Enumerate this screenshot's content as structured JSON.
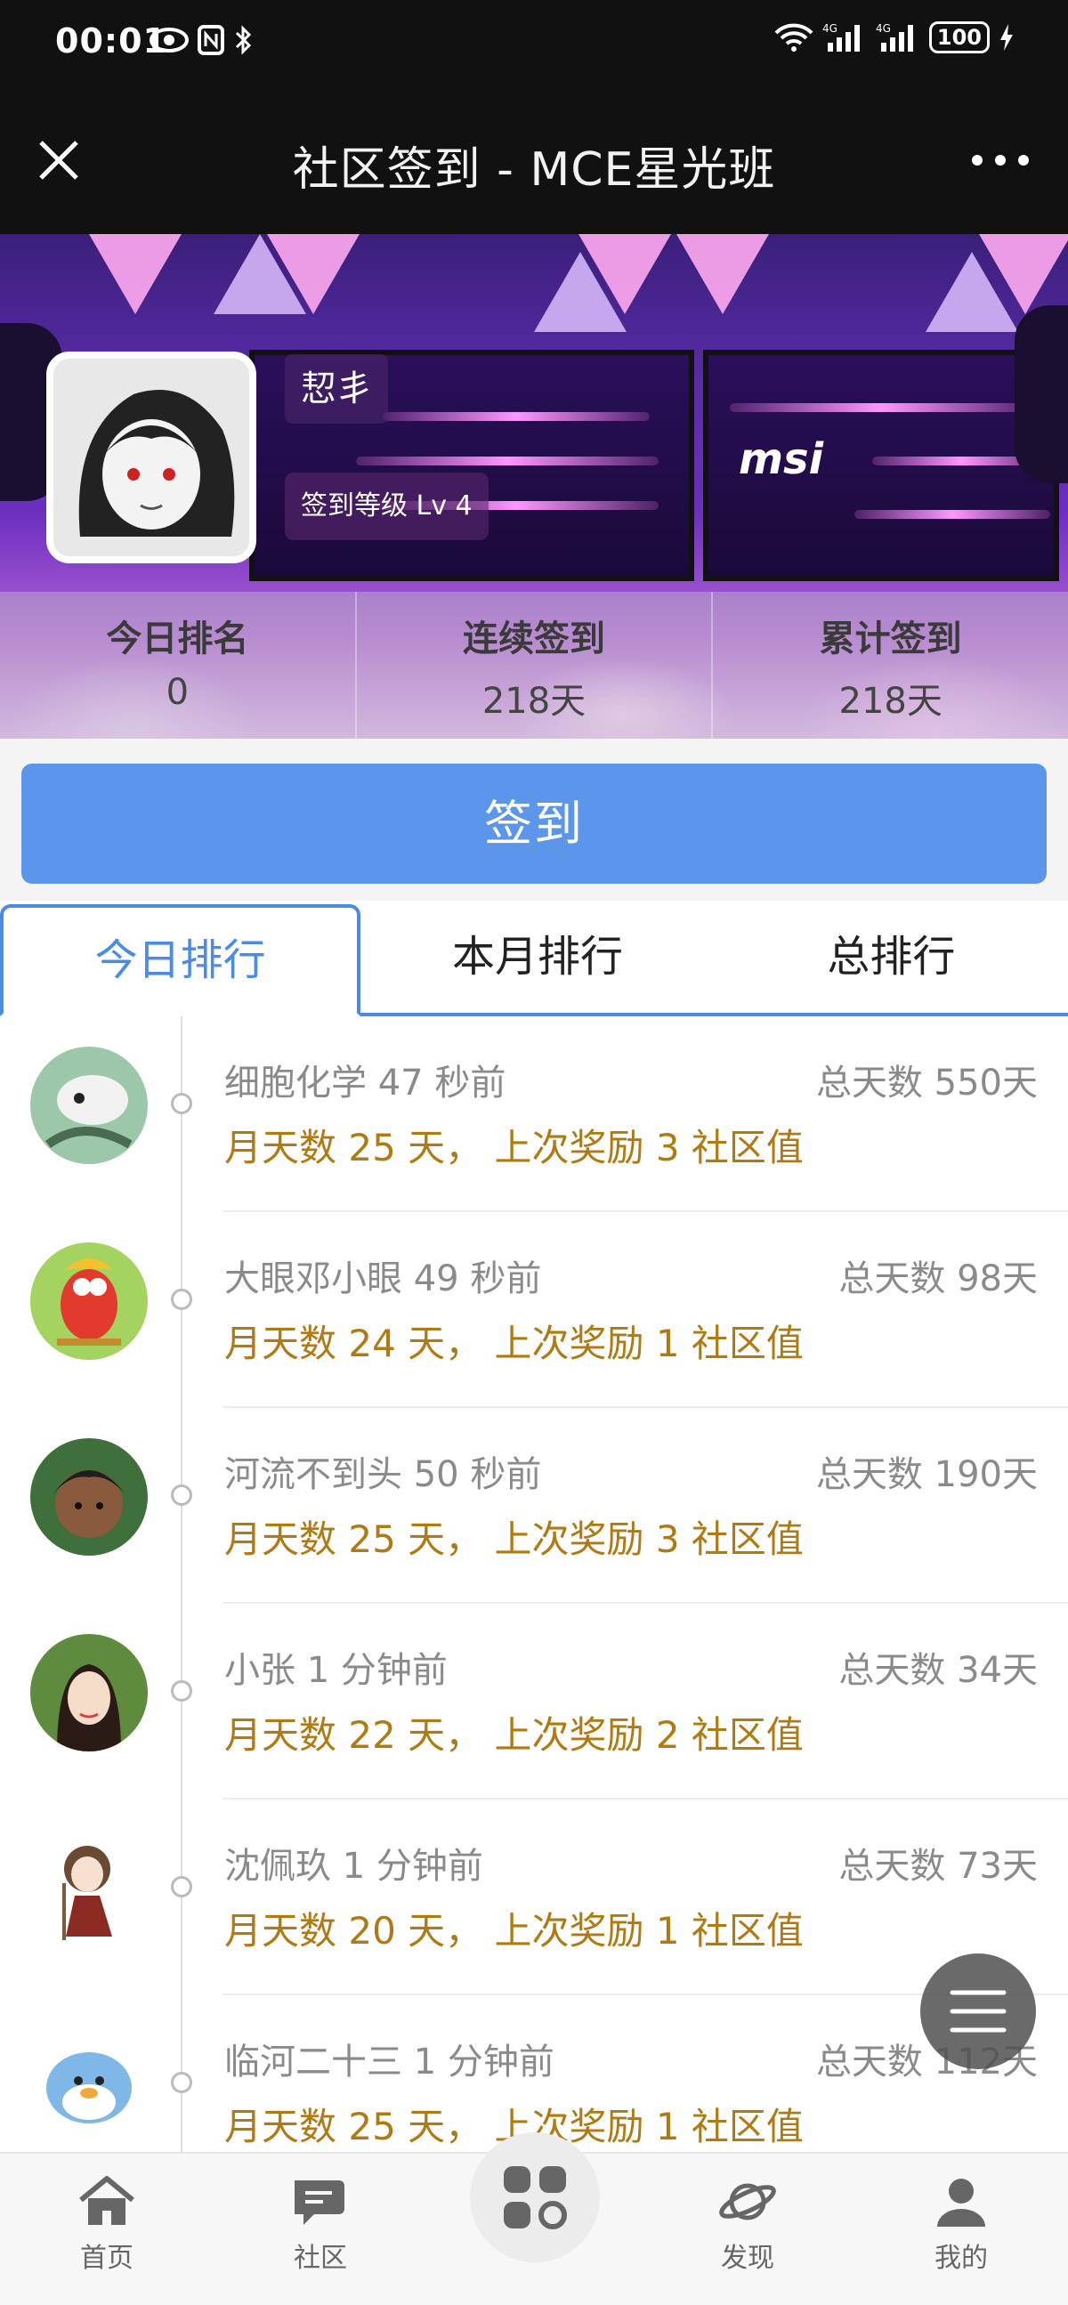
{
  "status_bar": {
    "time": "00:01",
    "battery": "100"
  },
  "title_bar": {
    "title": "社区签到 - MCE星光班"
  },
  "profile": {
    "username": "恝丯",
    "level": "签到等级 Lv 4",
    "stats": [
      {
        "label": "今日排名",
        "value": "0"
      },
      {
        "label": "连续签到",
        "value": "218天"
      },
      {
        "label": "累计签到",
        "value": "218天"
      }
    ]
  },
  "sign_button": {
    "label": "签到"
  },
  "tabs": [
    {
      "label": "今日排行",
      "active": true
    },
    {
      "label": "本月排行",
      "active": false
    },
    {
      "label": "总排行",
      "active": false
    }
  ],
  "ranking": [
    {
      "name": "细胞化学 47 秒前",
      "total": "总天数 550天",
      "detail": "月天数 25 天， 上次奖励 3 社区值"
    },
    {
      "name": "大眼邓小眼 49 秒前",
      "total": "总天数 98天",
      "detail": "月天数 24 天， 上次奖励 1 社区值"
    },
    {
      "name": "河流不到头 50 秒前",
      "total": "总天数 190天",
      "detail": "月天数 25 天， 上次奖励 3 社区值"
    },
    {
      "name": "小张 1 分钟前",
      "total": "总天数 34天",
      "detail": "月天数 22 天， 上次奖励 2 社区值"
    },
    {
      "name": "沈佩玖 1 分钟前",
      "total": "总天数 73天",
      "detail": "月天数 20 天， 上次奖励 1 社区值"
    },
    {
      "name": "临河二十三 1 分钟前",
      "total": "总天数 112天",
      "detail": "月天数 25 天， 上次奖励 1 社区值"
    }
  ],
  "bottom_nav": [
    {
      "label": "首页",
      "icon": "home-icon"
    },
    {
      "label": "社区",
      "icon": "chat-icon"
    },
    {
      "label": "",
      "icon": "apps-icon"
    },
    {
      "label": "发现",
      "icon": "planet-icon"
    },
    {
      "label": "我的",
      "icon": "user-icon"
    }
  ],
  "colors": {
    "accent": "#4a8be3",
    "sign_button": "#5b96ea",
    "detail_text": "#b07a12"
  }
}
